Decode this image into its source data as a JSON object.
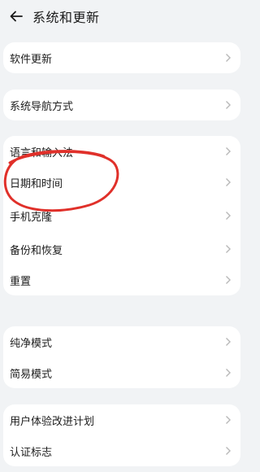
{
  "header": {
    "title": "系统和更新",
    "back_icon": "back-arrow-icon"
  },
  "groups": [
    {
      "items": [
        {
          "label": "软件更新"
        }
      ]
    },
    {
      "items": [
        {
          "label": "系统导航方式"
        }
      ]
    },
    {
      "items": [
        {
          "label": "语言和输入法"
        },
        {
          "label": "日期和时间"
        },
        {
          "label": "手机克隆"
        },
        {
          "label": "备份和恢复"
        },
        {
          "label": "重置"
        }
      ]
    },
    {
      "items": [
        {
          "label": "纯净模式"
        },
        {
          "label": "简易模式"
        }
      ]
    },
    {
      "items": [
        {
          "label": "用户体验改进计划"
        },
        {
          "label": "认证标志"
        }
      ]
    }
  ],
  "annotation": {
    "color": "#e0302a"
  }
}
